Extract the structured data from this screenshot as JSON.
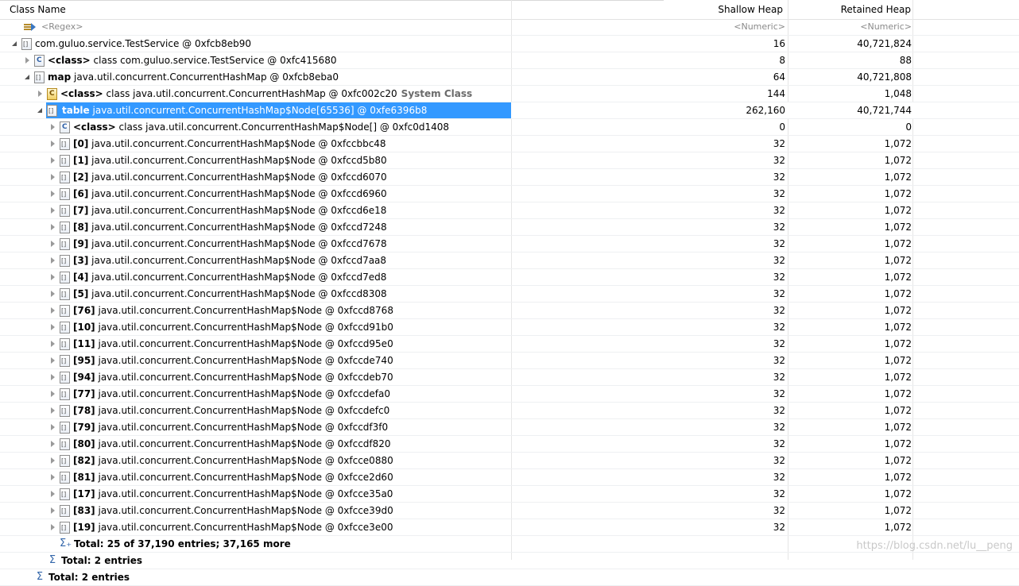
{
  "columns": {
    "name": "Class Name",
    "shallow": "Shallow Heap",
    "retained": "Retained Heap"
  },
  "filter": {
    "name": "<Regex>",
    "shallow": "<Numeric>",
    "retained": "<Numeric>"
  },
  "rows": [
    {
      "indent": 0,
      "twisty": "exp",
      "icon": "arr",
      "bold": "",
      "text": "com.guluo.service.TestService @ 0xfcb8eb90",
      "extra": "",
      "shallow": "16",
      "retained": "40,721,824"
    },
    {
      "indent": 1,
      "twisty": "col",
      "icon": "cls",
      "bold": "<class>",
      "text": "class com.guluo.service.TestService @ 0xfc415680",
      "extra": "",
      "shallow": "8",
      "retained": "88"
    },
    {
      "indent": 1,
      "twisty": "exp",
      "icon": "arr",
      "bold": "map",
      "text": "java.util.concurrent.ConcurrentHashMap @ 0xfcb8eba0",
      "extra": "",
      "shallow": "64",
      "retained": "40,721,808"
    },
    {
      "indent": 2,
      "twisty": "col",
      "icon": "gear",
      "bold": "<class>",
      "text": "class java.util.concurrent.ConcurrentHashMap @ 0xfc002c20",
      "extra": "System Class",
      "shallow": "144",
      "retained": "1,048"
    },
    {
      "indent": 2,
      "twisty": "exp",
      "icon": "arr",
      "bold": "table",
      "text": "java.util.concurrent.ConcurrentHashMap$Node[65536] @ 0xfe6396b8",
      "extra": "",
      "shallow": "262,160",
      "retained": "40,721,744",
      "selected": true
    },
    {
      "indent": 3,
      "twisty": "col",
      "icon": "cls",
      "bold": "<class>",
      "text": "class java.util.concurrent.ConcurrentHashMap$Node[] @ 0xfc0d1408",
      "extra": "",
      "shallow": "0",
      "retained": "0"
    },
    {
      "indent": 3,
      "twisty": "col",
      "icon": "arr",
      "bold": "[0]",
      "text": "java.util.concurrent.ConcurrentHashMap$Node @ 0xfccbbc48",
      "extra": "",
      "shallow": "32",
      "retained": "1,072"
    },
    {
      "indent": 3,
      "twisty": "col",
      "icon": "arr",
      "bold": "[1]",
      "text": "java.util.concurrent.ConcurrentHashMap$Node @ 0xfccd5b80",
      "extra": "",
      "shallow": "32",
      "retained": "1,072"
    },
    {
      "indent": 3,
      "twisty": "col",
      "icon": "arr",
      "bold": "[2]",
      "text": "java.util.concurrent.ConcurrentHashMap$Node @ 0xfccd6070",
      "extra": "",
      "shallow": "32",
      "retained": "1,072"
    },
    {
      "indent": 3,
      "twisty": "col",
      "icon": "arr",
      "bold": "[6]",
      "text": "java.util.concurrent.ConcurrentHashMap$Node @ 0xfccd6960",
      "extra": "",
      "shallow": "32",
      "retained": "1,072"
    },
    {
      "indent": 3,
      "twisty": "col",
      "icon": "arr",
      "bold": "[7]",
      "text": "java.util.concurrent.ConcurrentHashMap$Node @ 0xfccd6e18",
      "extra": "",
      "shallow": "32",
      "retained": "1,072"
    },
    {
      "indent": 3,
      "twisty": "col",
      "icon": "arr",
      "bold": "[8]",
      "text": "java.util.concurrent.ConcurrentHashMap$Node @ 0xfccd7248",
      "extra": "",
      "shallow": "32",
      "retained": "1,072"
    },
    {
      "indent": 3,
      "twisty": "col",
      "icon": "arr",
      "bold": "[9]",
      "text": "java.util.concurrent.ConcurrentHashMap$Node @ 0xfccd7678",
      "extra": "",
      "shallow": "32",
      "retained": "1,072"
    },
    {
      "indent": 3,
      "twisty": "col",
      "icon": "arr",
      "bold": "[3]",
      "text": "java.util.concurrent.ConcurrentHashMap$Node @ 0xfccd7aa8",
      "extra": "",
      "shallow": "32",
      "retained": "1,072"
    },
    {
      "indent": 3,
      "twisty": "col",
      "icon": "arr",
      "bold": "[4]",
      "text": "java.util.concurrent.ConcurrentHashMap$Node @ 0xfccd7ed8",
      "extra": "",
      "shallow": "32",
      "retained": "1,072"
    },
    {
      "indent": 3,
      "twisty": "col",
      "icon": "arr",
      "bold": "[5]",
      "text": "java.util.concurrent.ConcurrentHashMap$Node @ 0xfccd8308",
      "extra": "",
      "shallow": "32",
      "retained": "1,072"
    },
    {
      "indent": 3,
      "twisty": "col",
      "icon": "arr",
      "bold": "[76]",
      "text": "java.util.concurrent.ConcurrentHashMap$Node @ 0xfccd8768",
      "extra": "",
      "shallow": "32",
      "retained": "1,072"
    },
    {
      "indent": 3,
      "twisty": "col",
      "icon": "arr",
      "bold": "[10]",
      "text": "java.util.concurrent.ConcurrentHashMap$Node @ 0xfccd91b0",
      "extra": "",
      "shallow": "32",
      "retained": "1,072"
    },
    {
      "indent": 3,
      "twisty": "col",
      "icon": "arr",
      "bold": "[11]",
      "text": "java.util.concurrent.ConcurrentHashMap$Node @ 0xfccd95e0",
      "extra": "",
      "shallow": "32",
      "retained": "1,072"
    },
    {
      "indent": 3,
      "twisty": "col",
      "icon": "arr",
      "bold": "[95]",
      "text": "java.util.concurrent.ConcurrentHashMap$Node @ 0xfccde740",
      "extra": "",
      "shallow": "32",
      "retained": "1,072"
    },
    {
      "indent": 3,
      "twisty": "col",
      "icon": "arr",
      "bold": "[94]",
      "text": "java.util.concurrent.ConcurrentHashMap$Node @ 0xfccdeb70",
      "extra": "",
      "shallow": "32",
      "retained": "1,072"
    },
    {
      "indent": 3,
      "twisty": "col",
      "icon": "arr",
      "bold": "[77]",
      "text": "java.util.concurrent.ConcurrentHashMap$Node @ 0xfccdefa0",
      "extra": "",
      "shallow": "32",
      "retained": "1,072"
    },
    {
      "indent": 3,
      "twisty": "col",
      "icon": "arr",
      "bold": "[78]",
      "text": "java.util.concurrent.ConcurrentHashMap$Node @ 0xfccdefc0",
      "extra": "",
      "shallow": "32",
      "retained": "1,072"
    },
    {
      "indent": 3,
      "twisty": "col",
      "icon": "arr",
      "bold": "[79]",
      "text": "java.util.concurrent.ConcurrentHashMap$Node @ 0xfccdf3f0",
      "extra": "",
      "shallow": "32",
      "retained": "1,072"
    },
    {
      "indent": 3,
      "twisty": "col",
      "icon": "arr",
      "bold": "[80]",
      "text": "java.util.concurrent.ConcurrentHashMap$Node @ 0xfccdf820",
      "extra": "",
      "shallow": "32",
      "retained": "1,072"
    },
    {
      "indent": 3,
      "twisty": "col",
      "icon": "arr",
      "bold": "[82]",
      "text": "java.util.concurrent.ConcurrentHashMap$Node @ 0xfcce0880",
      "extra": "",
      "shallow": "32",
      "retained": "1,072"
    },
    {
      "indent": 3,
      "twisty": "col",
      "icon": "arr",
      "bold": "[81]",
      "text": "java.util.concurrent.ConcurrentHashMap$Node @ 0xfcce2d60",
      "extra": "",
      "shallow": "32",
      "retained": "1,072"
    },
    {
      "indent": 3,
      "twisty": "col",
      "icon": "arr",
      "bold": "[17]",
      "text": "java.util.concurrent.ConcurrentHashMap$Node @ 0xfcce35a0",
      "extra": "",
      "shallow": "32",
      "retained": "1,072"
    },
    {
      "indent": 3,
      "twisty": "col",
      "icon": "arr",
      "bold": "[83]",
      "text": "java.util.concurrent.ConcurrentHashMap$Node @ 0xfcce39d0",
      "extra": "",
      "shallow": "32",
      "retained": "1,072"
    },
    {
      "indent": 3,
      "twisty": "col",
      "icon": "arr",
      "bold": "[19]",
      "text": "java.util.concurrent.ConcurrentHashMap$Node @ 0xfcce3e00",
      "extra": "",
      "shallow": "32",
      "retained": "1,072"
    },
    {
      "indent": 3,
      "twisty": "none",
      "icon": "sigma-plus",
      "bold": "Total: 25 of 37,190 entries; 37,165 more",
      "text": "",
      "extra": "",
      "shallow": "",
      "retained": ""
    },
    {
      "indent": 2,
      "twisty": "none",
      "icon": "sigma",
      "bold": "Total: 2 entries",
      "text": "",
      "extra": "",
      "shallow": "",
      "retained": ""
    },
    {
      "indent": 1,
      "twisty": "none",
      "icon": "sigma",
      "bold": "Total: 2 entries",
      "text": "",
      "extra": "",
      "shallow": "",
      "retained": ""
    }
  ],
  "watermark": "https://blog.csdn.net/lu__peng"
}
